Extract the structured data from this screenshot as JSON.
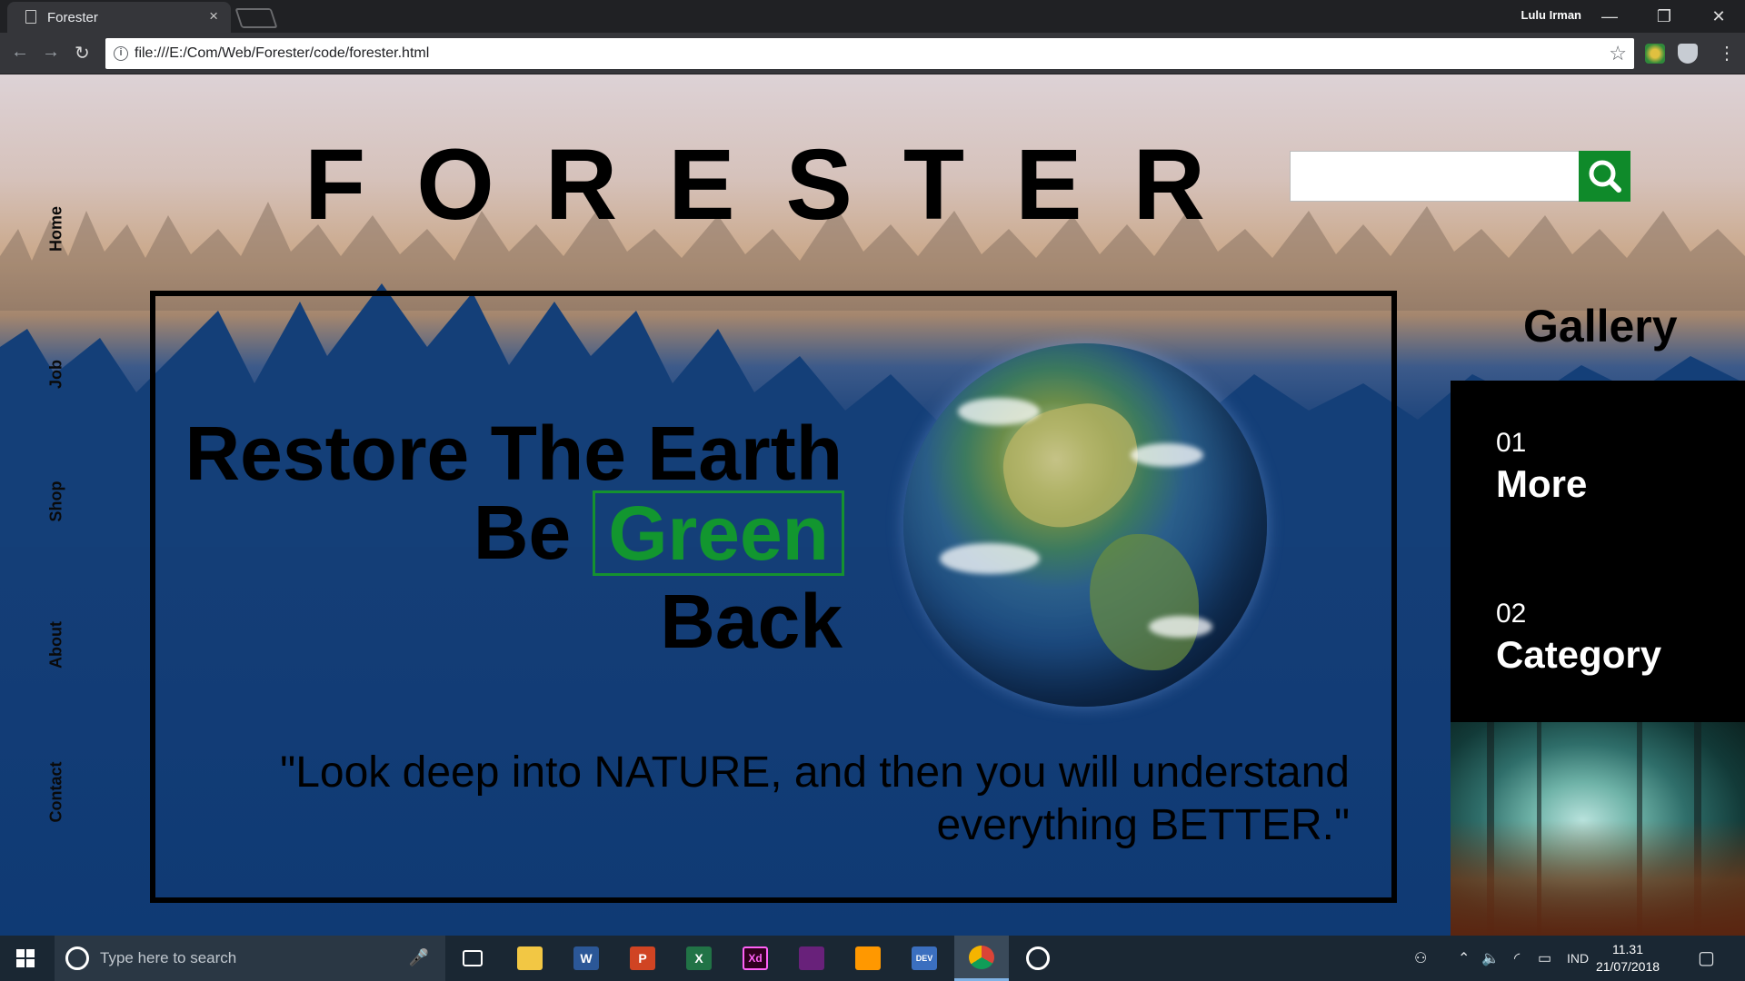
{
  "browser": {
    "tab_title": "Forester",
    "tab_close": "×",
    "user": "Lulu Irman",
    "window_buttons": {
      "minimize": "—",
      "restore": "❐",
      "close": "✕"
    },
    "back": "←",
    "forward": "→",
    "reload": "↻",
    "url": "file:///E:/Com/Web/Forester/code/forester.html",
    "info_icon": "i",
    "bookmark": "☆",
    "menu": "⋮"
  },
  "page": {
    "logo": "FORESTER",
    "nav": [
      "Home",
      "Job",
      "Shop",
      "About",
      "Contact"
    ],
    "search": {
      "value": "",
      "placeholder": ""
    },
    "hero": {
      "line1": "Restore The Earth",
      "line2_prefix": "Be",
      "line2_highlight": "Green",
      "line3": "Back",
      "quote": "\"Look deep into NATURE, and then you will understand everything BETTER.\""
    },
    "gallery": {
      "title": "Gallery",
      "items": [
        {
          "num": "01",
          "label": "More"
        },
        {
          "num": "02",
          "label": "Category"
        }
      ]
    },
    "colors": {
      "accent_green": "#12962f",
      "panel_black": "#000000",
      "sky_blue": "#0f3a74"
    }
  },
  "taskbar": {
    "search_placeholder": "Type here to search",
    "apps": [
      "task-view",
      "file-explorer",
      "word",
      "powerpoint",
      "excel",
      "adobe-xd",
      "visual-studio",
      "sublime-text",
      "dev-cpp",
      "chrome",
      "groove"
    ],
    "app_labels": {
      "word": "W",
      "powerpoint": "P",
      "excel": "X",
      "xd": "Xd",
      "dev": "DEV"
    },
    "language": "IND",
    "time": "11.31",
    "date": "21/07/2018"
  }
}
